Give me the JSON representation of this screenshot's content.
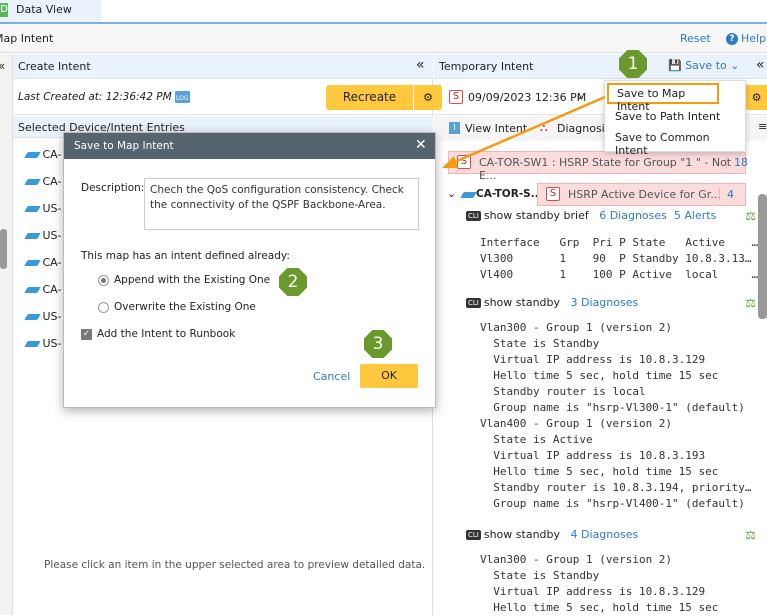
{
  "tabs": {
    "data_view": "Data View",
    "data_view_icon": "D"
  },
  "page": {
    "title": "Map Intent",
    "reset": "Reset",
    "help": "Help"
  },
  "create": {
    "title": "Create Intent",
    "last_created": "Last Created at: 12:36:42 PM",
    "log": "LOG",
    "recreate": "Recreate",
    "selected_title": "Selected Device/Intent Entries",
    "devices": [
      "CA-",
      "CA-",
      "US-",
      "US-",
      "CA-",
      "CA-",
      "US-",
      "US-"
    ],
    "preview_hint": "Please click an item in the upper selected area to preview detailed data."
  },
  "temp": {
    "title": "Temporary Intent",
    "save_to": "Save to",
    "date": "09/09/2023 12:36 PM",
    "s": "S",
    "view_intent": "View Intent",
    "diagnosis": "Diagnosis",
    "alert1": "CA-TOR-SW1 : HSRP State for Group \"1 \" - Not E...",
    "alert1_count": "18",
    "device": "CA-TOR-S...",
    "alert2": "HSRP Active Device for Gr...",
    "alert2_count": "4",
    "cmds": [
      {
        "name": "show standby brief",
        "diag": "6 Diagnoses",
        "alerts": "5 Alerts",
        "output": "Interface   Grp  Pri P State   Active    …\nVl300       1    90  P Standby 10.8.3.13…\nVl400       1    100 P Active  local     …"
      },
      {
        "name": "show standby",
        "diag": "3 Diagnoses",
        "alerts": "",
        "output": "Vlan300 - Group 1 (version 2)\n  State is Standby\n  Virtual IP address is 10.8.3.129\n  Hello time 5 sec, hold time 15 sec\n  Standby router is local\n  Group name is \"hsrp-Vl300-1\" (default)\nVlan400 - Group 1 (version 2)\n  State is Active\n  Virtual IP address is 10.8.3.193\n  Hello time 5 sec, hold time 15 sec\n  Standby router is 10.8.3.194, priority…\n  Group name is \"hsrp-Vl400-1\" (default)"
      },
      {
        "name": "show standby",
        "diag": "4 Diagnoses",
        "alerts": "",
        "output": "Vlan300 - Group 1 (version 2)\n  State is Standby\n  Virtual IP address is 10.8.3.129\n  Hello time 5 sec, hold time 15 sec"
      }
    ]
  },
  "menu": {
    "items": [
      "Save to Map Intent",
      "Save to Path Intent",
      "Save to Common Intent"
    ]
  },
  "dialog": {
    "title": "Save to Map Intent",
    "desc_label": "Description:",
    "desc": "Chech the QoS configuration consistency. Check the connectivity of the QSPF Backbone-Area.",
    "existing": "This map has an intent defined already:",
    "append": "Append with the Existing One",
    "overwrite": "Overwrite the Existing One",
    "runbook": "Add the Intent to Runbook",
    "cancel": "Cancel",
    "ok": "OK",
    "selected_option": "append",
    "runbook_checked": true
  },
  "steps": [
    "1",
    "2",
    "3"
  ],
  "colors": {
    "accent": "#ffc83d",
    "step": "#6a9a2e",
    "highlight": "#f39c12",
    "dialog_header": "#56646f"
  }
}
